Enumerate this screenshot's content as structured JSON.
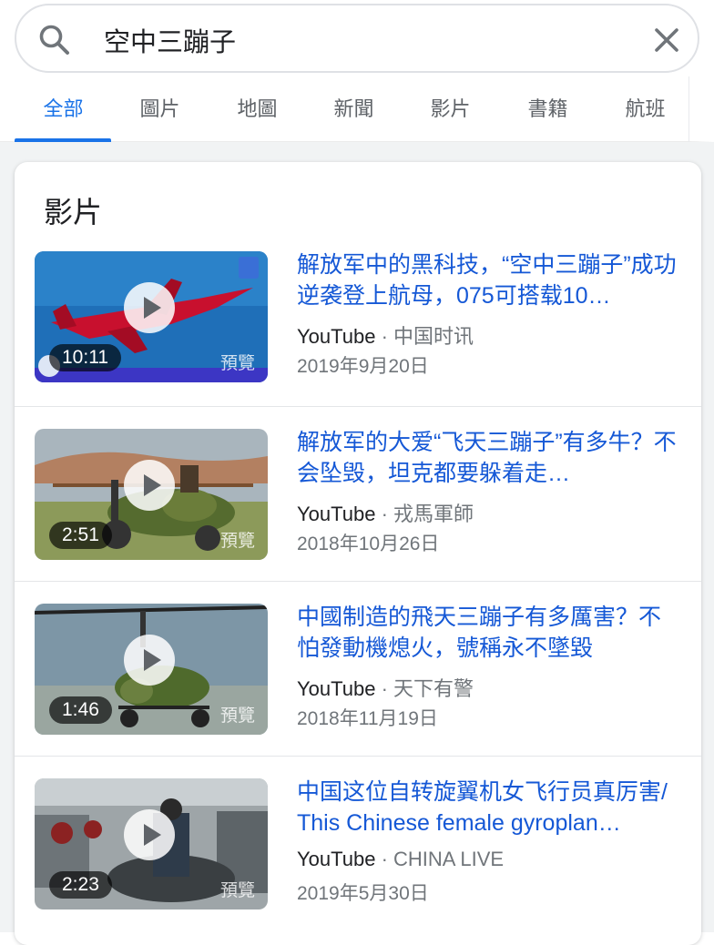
{
  "search": {
    "query": "空中三蹦子",
    "search_icon": "search-icon",
    "clear_icon": "close-icon"
  },
  "tabs": [
    {
      "label": "全部",
      "active": true
    },
    {
      "label": "圖片",
      "active": false
    },
    {
      "label": "地圖",
      "active": false
    },
    {
      "label": "新聞",
      "active": false
    },
    {
      "label": "影片",
      "active": false
    },
    {
      "label": "書籍",
      "active": false
    },
    {
      "label": "航班",
      "active": false
    }
  ],
  "card": {
    "title": "影片"
  },
  "videos": [
    {
      "title": "解放军中的黑科技，“空中三蹦子”成功逆袭登上航母，075可搭载10…",
      "duration": "10:11",
      "preview": "預覽",
      "source": "YouTube",
      "separator": "·",
      "channel": "中国时讯",
      "date": "2019年9月20日"
    },
    {
      "title": "解放军的大爱“飞天三蹦子”有多牛？不会坠毁，坦克都要躲着走…",
      "duration": "2:51",
      "preview": "預覽",
      "source": "YouTube",
      "separator": "·",
      "channel": "戎馬軍師",
      "date": "2018年10月26日"
    },
    {
      "title": "中國制造的飛天三蹦子有多厲害？不怕發動機熄火，號稱永不墜毀",
      "duration": "1:46",
      "preview": "預覽",
      "source": "YouTube",
      "separator": "·",
      "channel": "天下有警",
      "date": "2018年11月19日"
    },
    {
      "title": "中国这位自转旋翼机女飞行员真厉害/ This Chinese female gyroplan…",
      "duration": "2:23",
      "preview": "預覽",
      "source": "YouTube",
      "separator": "·",
      "channel": "CHINA LIVE",
      "date": "2019年5月30日"
    }
  ],
  "colors": {
    "accent": "#1a73e8",
    "link": "#1558d6",
    "text": "#202124",
    "muted": "#70757a"
  }
}
